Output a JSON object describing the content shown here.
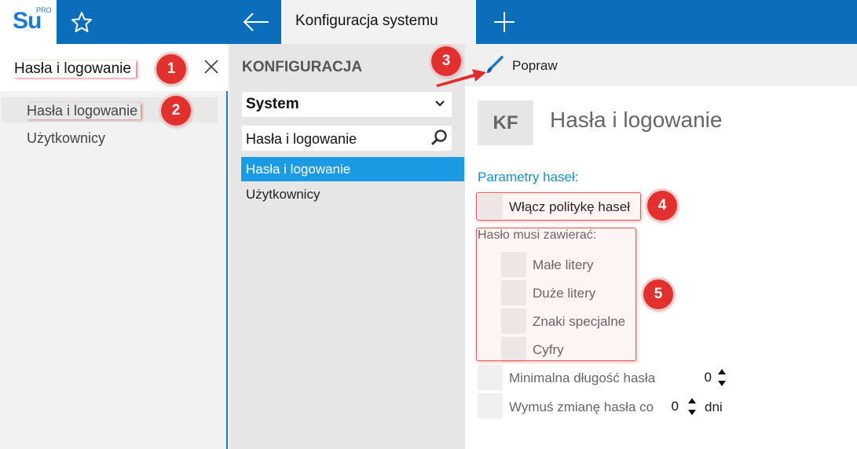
{
  "app": {
    "logo_text": "Su",
    "logo_badge": "PRO",
    "active_tab": "Konfiguracja systemu"
  },
  "left_panel": {
    "search_value": "Hasła i logowanie",
    "items": [
      {
        "label": "Hasła i logowanie"
      },
      {
        "label": "Użytkownicy"
      }
    ]
  },
  "middle_panel": {
    "heading": "KONFIGURACJA",
    "select_value": "System",
    "search_value": "Hasła i logowanie",
    "items": [
      {
        "label": "Hasła i logowanie",
        "selected": true
      },
      {
        "label": "Użytkownicy",
        "selected": false
      }
    ]
  },
  "toolbar": {
    "edit_label": "Popraw"
  },
  "content": {
    "badge": "KF",
    "title": "Hasła i logowanie",
    "section_label": "Parametry haseł:",
    "enable_policy_label": "Włącz politykę haseł",
    "must_contain_label": "Hasło musi zawierać:",
    "must_contain_options": [
      {
        "label": "Małe litery"
      },
      {
        "label": "Duże litery"
      },
      {
        "label": "Znaki specjalne"
      },
      {
        "label": "Cyfry"
      }
    ],
    "min_length_label": "Minimalna długość hasła",
    "min_length_value": "0",
    "force_change_label": "Wymuś zmianę hasła co",
    "force_change_value": "0",
    "force_change_unit": "dni"
  },
  "annotations": {
    "callouts": [
      "1",
      "2",
      "3",
      "4",
      "5"
    ]
  },
  "colors": {
    "topbar": "#0a6ebd",
    "selected_item": "#1b9be3",
    "section_label": "#1a8fd6",
    "callout": "#e2302f"
  },
  "icons": {
    "favorite": "star-icon",
    "back": "arrow-left-icon",
    "new_tab": "plus-icon",
    "clear": "close-icon",
    "dropdown": "chevron-down-icon",
    "search": "magnifier-icon",
    "edit": "brush-icon",
    "spinner": "spinner-arrows-icon"
  }
}
